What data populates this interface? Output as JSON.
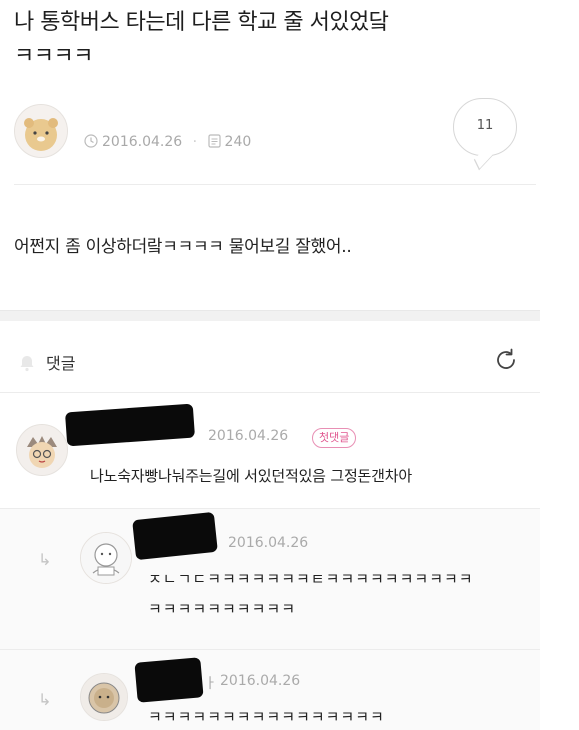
{
  "post": {
    "title_line1": "나 통학버스 타는데 다른 학교 줄 서있었닼",
    "title_line2": "ㅋㅋㅋㅋ",
    "date": "2016.04.26",
    "views": "240",
    "comment_count": "11",
    "body": "어쩐지 좀 이상하더랔ㅋㅋㅋㅋ 물어보길 잘했어.."
  },
  "comments_section": {
    "header": "댓글"
  },
  "comments": [
    {
      "date": "2016.04.26",
      "badge": "첫댓글",
      "text": "나노숙자빵나눠주는길에 서있던적있음 그정돈갠차아"
    }
  ],
  "replies": [
    {
      "date": "2016.04.26",
      "text_line1": "ㅈㄴㄱㄷㅋㅋㅋㅋㅋㅋㅋㅌㅋㅋㅋㅋㅋㅋㅋㅋㅋㅋ",
      "text_line2": "ㅋㅋㅋㅋㅋㅋㅋㅋㅋㅋ"
    },
    {
      "date": "2016.04.26",
      "suffix": "ㅏ",
      "text_line1": "ㅋㅋㅋㅋㅋㅋㅋㅋㅋㅋㅋㅋㅋㅋㅋㅋ"
    }
  ],
  "colors": {
    "badge_pink": "#e0578f",
    "meta_gray": "#a9a9a9"
  },
  "icons": {
    "clock": "clock-icon",
    "views": "document-icon",
    "bell": "bell-icon",
    "refresh": "refresh-icon",
    "reply": "reply-arrow-icon"
  }
}
